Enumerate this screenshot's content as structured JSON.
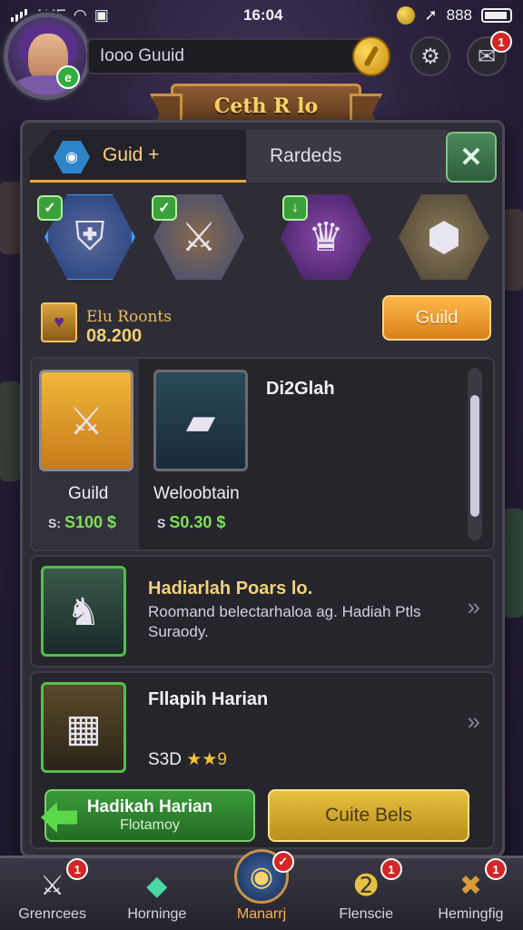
{
  "status": {
    "left": "AИE",
    "time": "16:04",
    "right": "888"
  },
  "header": {
    "search_text": "Iooo Guuid",
    "avatar_badge": "e",
    "notif_count": "1"
  },
  "banner": {
    "title": "Ceth R lo"
  },
  "tabs": [
    {
      "label": "Guid +",
      "active": true
    },
    {
      "label": "Rardeds",
      "active": false
    }
  ],
  "heroes": [
    {
      "name": "hero-knight"
    },
    {
      "name": "hero-warrior"
    },
    {
      "name": "hero-mage"
    },
    {
      "name": "hero-golem"
    }
  ],
  "rewards": {
    "label": "Elu Roonts",
    "value": "08.200",
    "button": "Guild"
  },
  "card1": {
    "title": "Di2Glah",
    "items": [
      {
        "name": "Guild",
        "price": "S100 $",
        "currency": "S:"
      },
      {
        "name": "Weloobtain",
        "price": "S0.30 $",
        "currency": "S"
      }
    ]
  },
  "card2": {
    "title": "Hadiarlah Poars lo.",
    "desc": "Roomand belectarhaloa ag. Hadiah Ptls Suraody."
  },
  "card3": {
    "title": "Fllapih Harian",
    "price": "S3D",
    "stars": "★★9",
    "btn_primary": {
      "line1": "Hadikah Harian",
      "line2": "Flotamoy"
    },
    "btn_secondary": "Cuite Bels"
  },
  "nav": [
    {
      "label": "Grenrcees",
      "badge": "1"
    },
    {
      "label": "Horninge",
      "badge": ""
    },
    {
      "label": "Manarrj",
      "badge": "",
      "active": true
    },
    {
      "label": "Flenscie",
      "badge": "1"
    },
    {
      "label": "Hemingfig",
      "badge": "1"
    }
  ],
  "colors": {
    "accent": "#ffb347",
    "gold": "#e6c040",
    "green": "#3a9a3a",
    "panel": "#2e2c35"
  }
}
